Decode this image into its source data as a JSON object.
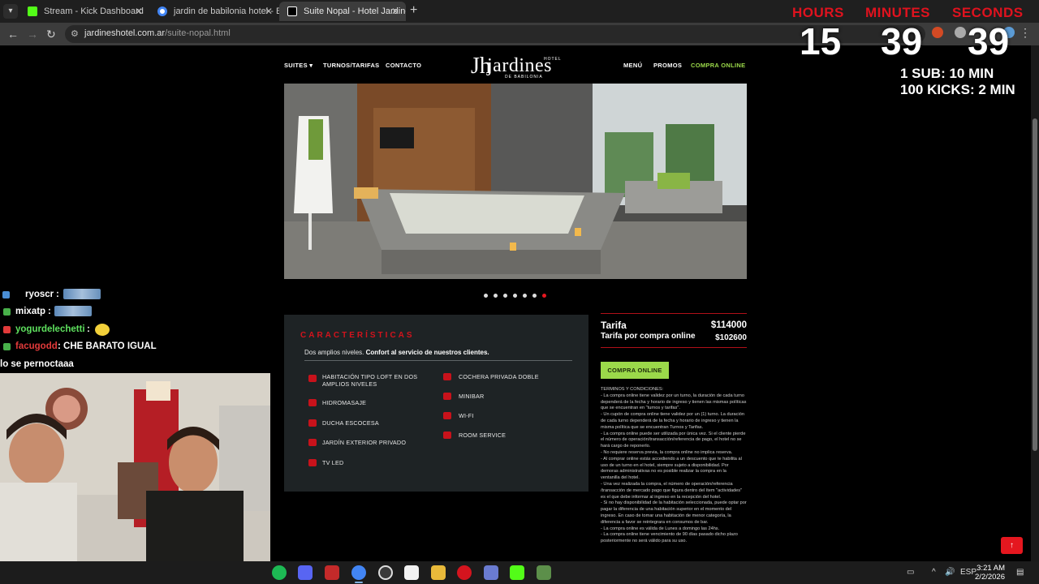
{
  "browser": {
    "tabs": [
      {
        "title": "Stream - Kick Dashboard",
        "favicon_color": "#53fc18"
      },
      {
        "title": "jardin de babilonia hotel - Busc",
        "favicon_color": "#4285f4"
      },
      {
        "title": "Suite Nopal - Hotel Jardines de",
        "favicon_color": "#ffffff"
      }
    ],
    "tab_close": "✕",
    "new_tab": "+",
    "url_domain": "jardineshotel.com.ar",
    "url_path": "/suite-nopal.html"
  },
  "timer": {
    "hours_label": "HOURS",
    "minutes_label": "MINUTES",
    "seconds_label": "SECONDS",
    "hours": "15",
    "minutes": "39",
    "seconds": "39",
    "rule_sub": "1 SUB: 10 MIN",
    "rule_kicks": "100 KICKS: 2 MIN",
    "accent": "#e0121e"
  },
  "site": {
    "nav_left": [
      "SUITES ▾",
      "TURNOS/TARIFAS",
      "CONTACTO"
    ],
    "nav_right": [
      "MENÚ",
      "PROMOS",
      "COMPRA ONLINE"
    ],
    "nav_highlight_color": "#9bd94a",
    "logo_name": "jardines",
    "logo_sub": "DE BABILONIA",
    "logo_hotel": "HOTEL",
    "slider_total": 7,
    "slider_active": 7,
    "features": {
      "title": "CARACTERÍSTICAS",
      "intro_plain": "Dos amplios niveles.",
      "intro_bold": "Confort al servicio de nuestros clientes.",
      "left": [
        "HABITACIÓN TIPO LOFT EN DOS AMPLIOS NIVELES",
        "HIDROMASAJE",
        "DUCHA ESCOCESA",
        "JARDÍN EXTERIOR PRIVADO",
        "TV LED"
      ],
      "right": [
        "COCHERA PRIVADA DOBLE",
        "MINIBAR",
        "WI-FI",
        "ROOM SERVICE"
      ]
    },
    "rates": {
      "tarifa_label": "Tarifa",
      "tarifa_value": "$114000",
      "online_label": "Tarifa por compra online",
      "online_value": "$102600",
      "buy_button": "COMPRA ONLINE"
    },
    "terms": "TÉRMINOS Y CONDICIONES:\n- La compra online tiene validez por un turno, la duración de cada turno dependerá de la fecha y horario de ingreso y tienen las mismas políticas que se encuentran en \"turnos y tarifas\".\n- Un cupón de compra online tiene validez por un (1) turno. La duración de cada turno dependerá de la fecha y horario de ingreso y tienen la misma política que se encuentran Turnos y Tarifas.\n- La compra online puede ser utilizada por única vez. Si el cliente pierde el número de operación/transacción/referencia de pago, el hotel no se hará cargo de reponerlo.\n- No requiere reserva previa, la compra online no implica reserva.\n- Al comprar online estás accediendo a un descuento que te habilita al uso de un turno en el hotel, siempre sujeto a disponibilidad. Por demoras administrativas no es posible realizar la compra en la ventanilla del hotel.\n- Una vez realizada la compra, el número de operación/referencia /transacción de mercado pago que figura dentro del ítem \"actividades\" es el que debe informar al ingreso en la recepción del hotel.\n- Si no hay disponibilidad de la habitación seleccionada, puede optar por pagar la diferencia de una habitación superior en el momento del ingreso. En caso de tomar una habitación de menor categoría, la diferencia a favor se reintegrara en consumos de bar.\n- La compra online es válida de Lunes a domingo las 24hs.\n- La compra online tiene vencimiento de 90 días pasado dicho plazo posteriormente no será válido para su uso.",
    "back_to_top": "↑"
  },
  "chat": [
    {
      "user": "ryoscr",
      "msg": "",
      "user_color": "#ffffff",
      "emote": true
    },
    {
      "user": "mixatp",
      "msg": "",
      "user_color": "#ffffff",
      "emote": true
    },
    {
      "user": "yogurdelechetti",
      "msg": "",
      "user_color": "#5ee05e",
      "emote": false,
      "face_emote": true
    },
    {
      "user": "facugodd",
      "msg": ": CHE BARATO IGUAL",
      "user_color": "#e23a3a",
      "emote": false
    },
    {
      "user": "",
      "msg": "lo se pernoctaaa",
      "user_color": "#ffffff",
      "emote": false
    }
  ],
  "taskbar": {
    "tray_lang": "ESP",
    "time": "3:21 AM",
    "date": "2/2/2026"
  }
}
